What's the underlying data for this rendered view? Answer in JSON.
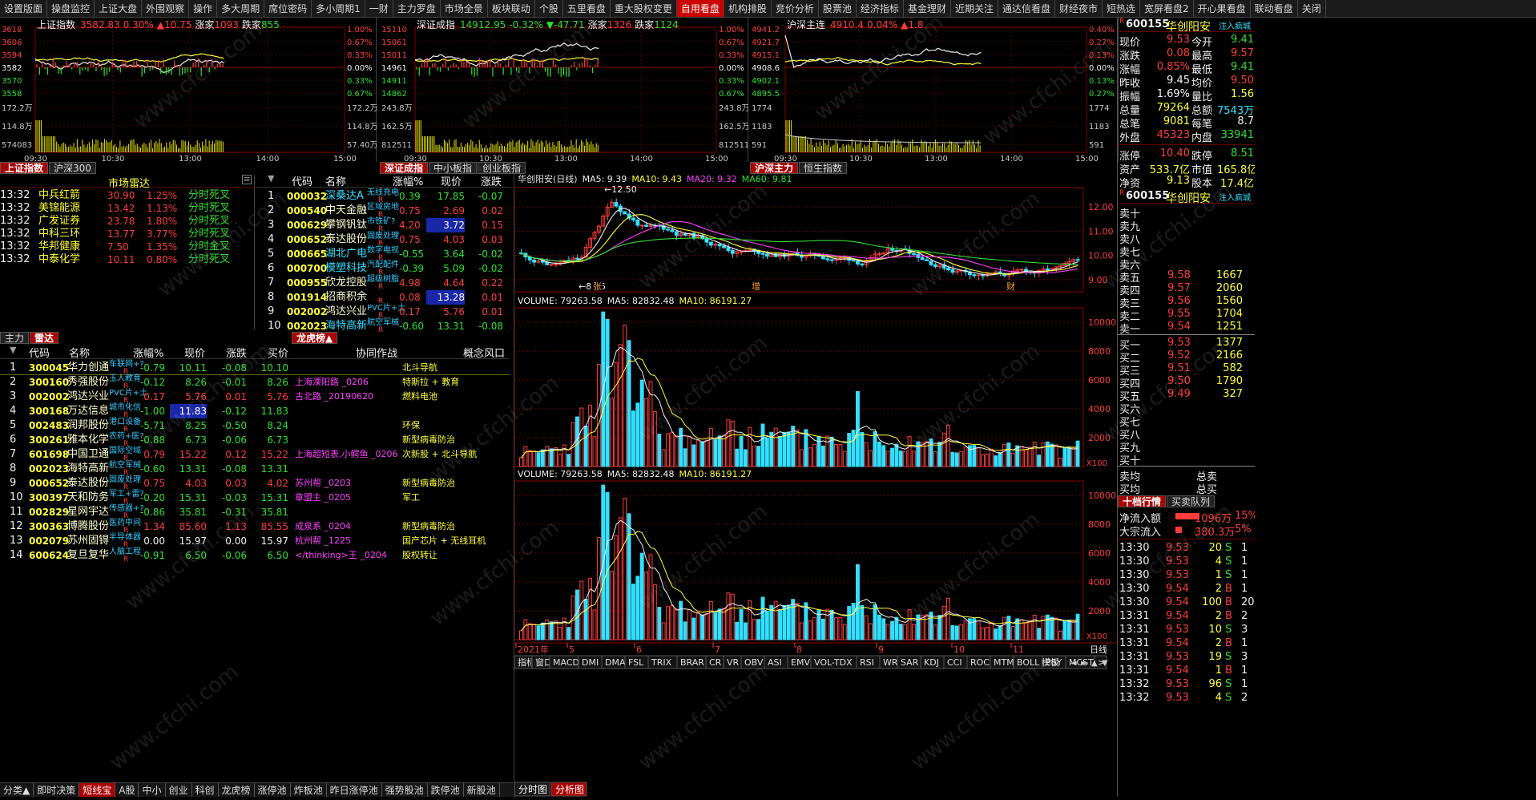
{
  "topnav": [
    "设置版面",
    "操盘监控",
    "上证大盘",
    "外围观察",
    "操作",
    "多大周期",
    "席位密码",
    "多小周期1",
    "一财",
    "主力罗盘",
    "市场全景",
    "板块联动",
    "个股",
    "五里看盘",
    "重大股权变更",
    "自用看盘",
    "机构排股",
    "竞价分析",
    "股票池",
    "经济指标",
    "基金理财",
    "近期关注",
    "通达信看盘",
    "财经夜市",
    "短热选",
    "宽屏看盘2",
    "开心果看盘",
    "联动看盘",
    "关闭"
  ],
  "topnav_active": 15,
  "minis": [
    {
      "title": "上证指数",
      "price": "3582.83",
      "pct": "0.30%",
      "chg": "▲10.75",
      "up_label": "涨家",
      "up": "1093",
      "down_label": "跌家",
      "down": "855",
      "yl": [
        "3618",
        "3606",
        "3594",
        "3582",
        "3570",
        "3558",
        "172.2万",
        "114.8万",
        "574083"
      ],
      "yr": [
        "1.00%",
        "0.67%",
        "0.33%",
        "0.00%",
        "0.33%",
        "0.67%",
        "172.2万",
        "114.8万",
        "57.40万"
      ],
      "xt": [
        "09:30",
        "10:30",
        "13:00",
        "14:00",
        "15:00"
      ],
      "tabs": [
        "上证指数",
        "沪深300"
      ]
    },
    {
      "title": "深证成指",
      "price": "14912.95",
      "pct": "-0.32%",
      "chg": "▼-47.71",
      "up_label": "涨家",
      "up": "1326",
      "down_label": "跌家",
      "down": "1124",
      "yl": [
        "15110",
        "15061",
        "15011",
        "14961",
        "14911",
        "14862",
        "243.8万",
        "162.5万",
        "812511"
      ],
      "yr": [
        "1.00%",
        "0.67%",
        "0.33%",
        "0.00%",
        "0.33%",
        "0.67%",
        "243.8万",
        "162.5万",
        "812511"
      ],
      "xt": [
        "09:30",
        "10:30",
        "13:00",
        "14:00",
        "15:00"
      ],
      "tabs": [
        "深证成指",
        "中小板指",
        "创业板指"
      ]
    },
    {
      "title": "沪深主连",
      "price": "4910.4",
      "pct": "0.04%",
      "chg": "▲1.8",
      "up_label": "",
      "up": "",
      "down_label": "",
      "down": "",
      "yl": [
        "4941.2",
        "4921.7",
        "4915.1",
        "4908.6",
        "4902.1",
        "4895.5",
        "1774",
        "1183",
        "591"
      ],
      "yr": [
        "0.40%",
        "0.27%",
        "0.13%",
        "0.00%",
        "0.13%",
        "0.27%",
        "1774",
        "1183",
        "591"
      ],
      "xt": [
        "09:30",
        "10:30",
        "13:00",
        "14:00",
        "15:00"
      ],
      "tabs": [
        "沪深主力",
        "恒生指数"
      ]
    }
  ],
  "radar": {
    "title": "市场雷达",
    "rows": [
      {
        "t": "13:32",
        "n": "中兵红箭",
        "p": "30.90",
        "c": "1.25%",
        "e": "分时死叉"
      },
      {
        "t": "13:32",
        "n": "美锦能源",
        "p": "13.42",
        "c": "1.13%",
        "e": "分时死叉"
      },
      {
        "t": "13:32",
        "n": "广发证券",
        "p": "23.78",
        "c": "1.80%",
        "e": "分时死叉"
      },
      {
        "t": "13:32",
        "n": "中科三环",
        "p": "13.77",
        "c": "3.77%",
        "e": "分时死叉"
      },
      {
        "t": "13:32",
        "n": "华邦健康",
        "p": "7.50",
        "c": "1.35%",
        "e": "分时金叉"
      },
      {
        "t": "13:32",
        "n": "中泰化学",
        "p": "10.11",
        "c": "0.80%",
        "e": "分时死叉"
      }
    ]
  },
  "hot": {
    "headers": [
      "代码",
      "名称",
      "涨幅%",
      "现价",
      "涨跌"
    ],
    "rows": [
      {
        "i": "1",
        "code": "000032",
        "name": "深桑达A",
        "tag": "无线充电",
        "pct": "0.39",
        "price": "17.85",
        "chg": "-0.07",
        "dir": "d"
      },
      {
        "i": "2",
        "code": "000540",
        "name": "中天金融",
        "tag": "区域房地",
        "pct": "0.75",
        "price": "2.69",
        "chg": "0.02",
        "dir": "u"
      },
      {
        "i": "3",
        "code": "000629",
        "name": "攀钢钒钛",
        "tag": "市铁矿?",
        "pct": "4.20",
        "price": "3.72",
        "chg": "0.15",
        "dir": "u",
        "hl": true
      },
      {
        "i": "4",
        "code": "000652",
        "name": "泰达股份",
        "tag": "固废处理",
        "pct": "0.75",
        "price": "4.03",
        "chg": "0.03",
        "dir": "u"
      },
      {
        "i": "5",
        "code": "000665",
        "name": "湖北广电",
        "tag": "数字电视",
        "pct": "-0.55",
        "price": "3.64",
        "chg": "-0.02",
        "dir": "d"
      },
      {
        "i": "6",
        "code": "000700",
        "name": "模塑科技",
        "tag": "汽配配件",
        "pct": "-0.39",
        "price": "5.09",
        "chg": "-0.02",
        "dir": "d"
      },
      {
        "i": "7",
        "code": "000955",
        "name": "欣龙控股",
        "tag": "超级树脂",
        "pct": "4.98",
        "price": "4.64",
        "chg": "0.22",
        "dir": "u"
      },
      {
        "i": "8",
        "code": "001914",
        "name": "招商积余",
        "tag": "",
        "pct": "0.08",
        "price": "13.28",
        "chg": "0.01",
        "dir": "u",
        "hl": true
      },
      {
        "i": "9",
        "code": "002002",
        "name": "鸿达兴业",
        "tag": "PVC片+土",
        "pct": "0.17",
        "price": "5.76",
        "chg": "0.01",
        "dir": "u"
      },
      {
        "i": "10",
        "code": "002023",
        "name": "海特高新",
        "tag": "航空军械",
        "pct": "-0.60",
        "price": "13.31",
        "chg": "-0.08",
        "dir": "d"
      }
    ]
  },
  "bigtabs": [
    "主力",
    "雷达",
    "龙虎榜▲"
  ],
  "big": {
    "headers": [
      "代码",
      "名称",
      "涨幅%",
      "现价",
      "涨跌",
      "买价",
      "协同作战",
      "概念风口"
    ],
    "rows": [
      {
        "i": "1",
        "code": "300045",
        "name": "华力创通",
        "tag": "车联网+?",
        "pct": "-0.79",
        "price": "10.11",
        "chg": "-0.08",
        "buy": "10.10",
        "xz": "",
        "gn": "北斗导航",
        "dir": "d"
      },
      {
        "i": "2",
        "code": "300160",
        "name": "秀强股份",
        "tag": "玉人教育",
        "pct": "-0.12",
        "price": "8.26",
        "chg": "-0.01",
        "buy": "8.26",
        "xz": "上海溧阳路  _0206",
        "gn": "特斯拉 + 教育",
        "dir": "d"
      },
      {
        "i": "3",
        "code": "002002",
        "name": "鸿达兴业",
        "tag": "PVC片+土",
        "pct": "0.17",
        "price": "5.76",
        "chg": "0.01",
        "buy": "5.76",
        "xz": "古北路  _20190620",
        "gn": "燃料电池",
        "dir": "u"
      },
      {
        "i": "4",
        "code": "300168",
        "name": "万达信息",
        "tag": "城市化信",
        "pct": "-1.00",
        "price": "11.83",
        "chg": "-0.12",
        "buy": "11.83",
        "xz": "",
        "gn": "",
        "dir": "d",
        "hl": true
      },
      {
        "i": "5",
        "code": "002483",
        "name": "润邦股份",
        "tag": "港口设备",
        "pct": "-5.71",
        "price": "8.25",
        "chg": "-0.50",
        "buy": "8.24",
        "xz": "",
        "gn": "环保",
        "dir": "d"
      },
      {
        "i": "6",
        "code": "300261",
        "name": "雅本化学",
        "tag": "农药+医?",
        "pct": "-0.88",
        "price": "6.73",
        "chg": "-0.06",
        "buy": "6.73",
        "xz": "",
        "gn": "新型病毒防治",
        "dir": "d"
      },
      {
        "i": "7",
        "code": "601698",
        "name": "中国卫通",
        "tag": "国际空域",
        "pct": "0.79",
        "price": "15.22",
        "chg": "0.12",
        "buy": "15.22",
        "xz": "上海超短表,小鳄鱼  _0206",
        "gn": "次新股 + 北斗导航",
        "dir": "u"
      },
      {
        "i": "8",
        "code": "002023",
        "name": "海特高新",
        "tag": "航空军械",
        "pct": "-0.60",
        "price": "13.31",
        "chg": "-0.08",
        "buy": "13.31",
        "xz": "",
        "gn": "",
        "dir": "d"
      },
      {
        "i": "9",
        "code": "000652",
        "name": "泰达股份",
        "tag": "固废处理",
        "pct": "0.75",
        "price": "4.03",
        "chg": "0.03",
        "buy": "4.02",
        "xz": "苏州帮  _0203",
        "gn": "新型病毒防治",
        "dir": "u"
      },
      {
        "i": "10",
        "code": "300397",
        "name": "天和防务",
        "tag": "军工+雷?",
        "pct": "-0.20",
        "price": "15.31",
        "chg": "-0.03",
        "buy": "15.31",
        "xz": "章盟主  _0205",
        "gn": "军工",
        "dir": "d"
      },
      {
        "i": "11",
        "code": "002829",
        "name": "星网宇达",
        "tag": "传感器+?",
        "pct": "-0.86",
        "price": "35.81",
        "chg": "-0.31",
        "buy": "35.81",
        "xz": "",
        "gn": "",
        "dir": "d"
      },
      {
        "i": "12",
        "code": "300363",
        "name": "博腾股份",
        "tag": "医药中间",
        "pct": "1.34",
        "price": "85.60",
        "chg": "1.13",
        "buy": "85.55",
        "xz": "成泉系  _0204",
        "gn": "新型病毒防治",
        "dir": "u"
      },
      {
        "i": "13",
        "code": "002079",
        "name": "苏州固锝",
        "tag": "半导体器",
        "pct": "0.00",
        "price": "15.97",
        "chg": "0.00",
        "buy": "15.97",
        "xz": "杭州帮  _1225",
        "gn": "国产芯片 + 无线耳机",
        "dir": "z"
      },
      {
        "i": "14",
        "code": "600624",
        "name": "复旦复华",
        "tag": "人脑工程",
        "pct": "-0.91",
        "price": "6.50",
        "chg": "-0.06",
        "buy": "6.50",
        "xz": "</thinking>王  _0204",
        "gn": "股权转让",
        "dir": "d"
      }
    ]
  },
  "left_bottom": [
    "分类▲",
    "即时决策",
    "短线宝",
    "A股",
    "中小",
    "创业",
    "科创",
    "龙虎榜",
    "涨停池",
    "炸板池",
    "昨日涨停池",
    "强势股池",
    "跌停池",
    "新股池"
  ],
  "left_bottom_active": 2,
  "kline": {
    "title": "华创阳安(日线)",
    "ma5": "MA5: 9.39",
    "ma10": "MA10: 9.43",
    "ma20": "MA20: 9.32",
    "ma60": "MA60: 9.81",
    "price_ticks": [
      "12.00",
      "11.00",
      "10.00",
      "9.00"
    ],
    "hi": "12.50",
    "lo": "8.56",
    "marks": [
      "张",
      "增",
      "财"
    ],
    "vol_title": "VOLUME: 79263.58",
    "vol_ma5": "MA5: 82832.48",
    "vol_ma10": "MA10: 86191.27",
    "vol_ticks": [
      "10000",
      "8000",
      "6000",
      "4000",
      "2000"
    ],
    "vol_unit": "X100",
    "date_labels": [
      "2021年",
      "5",
      "6",
      "7",
      "8",
      "9",
      "10",
      "11"
    ],
    "period": "日线",
    "indicators": [
      "指标",
      "窗口",
      "MACD",
      "DMI",
      "DMA",
      "FSL",
      "TRIX",
      "BRAR",
      "CR",
      "VR",
      "OBV",
      "ASI",
      "EMV",
      "VOL-TDX",
      "RSI",
      "WR",
      "SAR",
      "KDJ",
      "CCI",
      "ROC",
      "MTM",
      "BOLL",
      "PSY",
      "MCST",
      ">"
    ],
    "plate": "模板",
    "bottom_tabs": [
      "分时图",
      "分析图"
    ]
  },
  "quote": {
    "code": "600155",
    "name": "华创阳安",
    "flag": "注入疯城",
    "rows": [
      [
        "现价",
        "9.53",
        "今开",
        "9.41"
      ],
      [
        "涨跌",
        "0.08",
        "最高",
        "9.57"
      ],
      [
        "涨幅",
        "0.85%",
        "最低",
        "9.41"
      ],
      [
        "昨收",
        "9.45",
        "均价",
        "9.50"
      ],
      [
        "振幅",
        "1.69%",
        "量比",
        "1.56"
      ],
      [
        "总量",
        "79264",
        "总额",
        "7543万"
      ],
      [
        "总笔",
        "9081",
        "每笔",
        "8.7"
      ],
      [
        "外盘",
        "45323",
        "内盘",
        "33941"
      ]
    ],
    "rows2": [
      [
        "涨停",
        "10.40",
        "跌停",
        "8.51"
      ],
      [
        "资产",
        "533.7亿",
        "市值",
        "165.8亿"
      ],
      [
        "净资",
        "9.13",
        "股本",
        "17.4亿"
      ]
    ],
    "sells": [
      [
        "卖十",
        "",
        ""
      ],
      [
        "卖九",
        "",
        ""
      ],
      [
        "卖八",
        "",
        ""
      ],
      [
        "卖七",
        "",
        ""
      ],
      [
        "卖六",
        "",
        ""
      ],
      [
        "卖五",
        "9.58",
        "1667"
      ],
      [
        "卖四",
        "9.57",
        "2060"
      ],
      [
        "卖三",
        "9.56",
        "1560"
      ],
      [
        "卖二",
        "9.55",
        "1704"
      ],
      [
        "卖一",
        "9.54",
        "1251"
      ]
    ],
    "buys": [
      [
        "买一",
        "9.53",
        "1377"
      ],
      [
        "买二",
        "9.52",
        "2166"
      ],
      [
        "买三",
        "9.51",
        "582"
      ],
      [
        "买四",
        "9.50",
        "1790"
      ],
      [
        "买五",
        "9.49",
        "327"
      ],
      [
        "买六",
        "",
        ""
      ],
      [
        "买七",
        "",
        ""
      ],
      [
        "买八",
        "",
        ""
      ],
      [
        "买九",
        "",
        ""
      ],
      [
        "买十",
        "",
        ""
      ]
    ],
    "sum": [
      [
        "卖均",
        "总卖"
      ],
      [
        "买均",
        "总买"
      ]
    ],
    "tabs": [
      "十档行情",
      "买卖队列"
    ],
    "flow": [
      [
        "净流入额",
        "1096万",
        "15%"
      ],
      [
        "大宗流入",
        "380.3万",
        "5%"
      ]
    ],
    "ticks": [
      [
        "13:30",
        "9.53",
        "20",
        "S",
        "1"
      ],
      [
        "13:30",
        "9.53",
        "4",
        "S",
        "1"
      ],
      [
        "13:30",
        "9.53",
        "1",
        "S",
        "1"
      ],
      [
        "13:30",
        "9.54",
        "2",
        "B",
        "1"
      ],
      [
        "13:30",
        "9.54",
        "100",
        "B",
        "20"
      ],
      [
        "13:31",
        "9.54",
        "2",
        "B",
        "2"
      ],
      [
        "13:31",
        "9.53",
        "10",
        "S",
        "3"
      ],
      [
        "13:31",
        "9.54",
        "2",
        "B",
        "1"
      ],
      [
        "13:31",
        "9.53",
        "19",
        "S",
        "3"
      ],
      [
        "13:31",
        "9.54",
        "1",
        "B",
        "1"
      ],
      [
        "13:32",
        "9.53",
        "96",
        "S",
        "1"
      ],
      [
        "13:32",
        "9.53",
        "4",
        "S",
        "2"
      ]
    ]
  },
  "watermark": "www.cfchi.com"
}
